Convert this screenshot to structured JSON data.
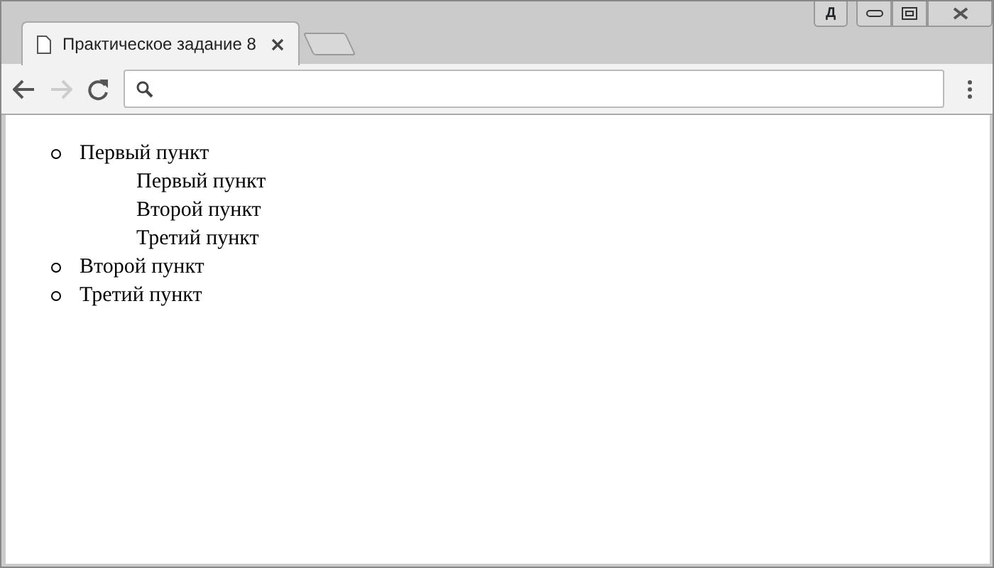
{
  "window": {
    "ime_indicator": "Д"
  },
  "tabs": [
    {
      "title": "Практическое задание 8",
      "selected": true
    }
  ],
  "toolbar": {
    "back_enabled": true,
    "forward_enabled": false
  },
  "content": {
    "list": [
      {
        "text": "Первый пункт",
        "bulleted": true,
        "children": [
          {
            "text": "Первый пункт",
            "bulleted": false
          },
          {
            "text": "Второй пункт",
            "bulleted": false
          },
          {
            "text": "Третий пункт",
            "bulleted": false
          }
        ]
      },
      {
        "text": "Второй пункт",
        "bulleted": true
      },
      {
        "text": "Третий пункт",
        "bulleted": true
      }
    ]
  }
}
